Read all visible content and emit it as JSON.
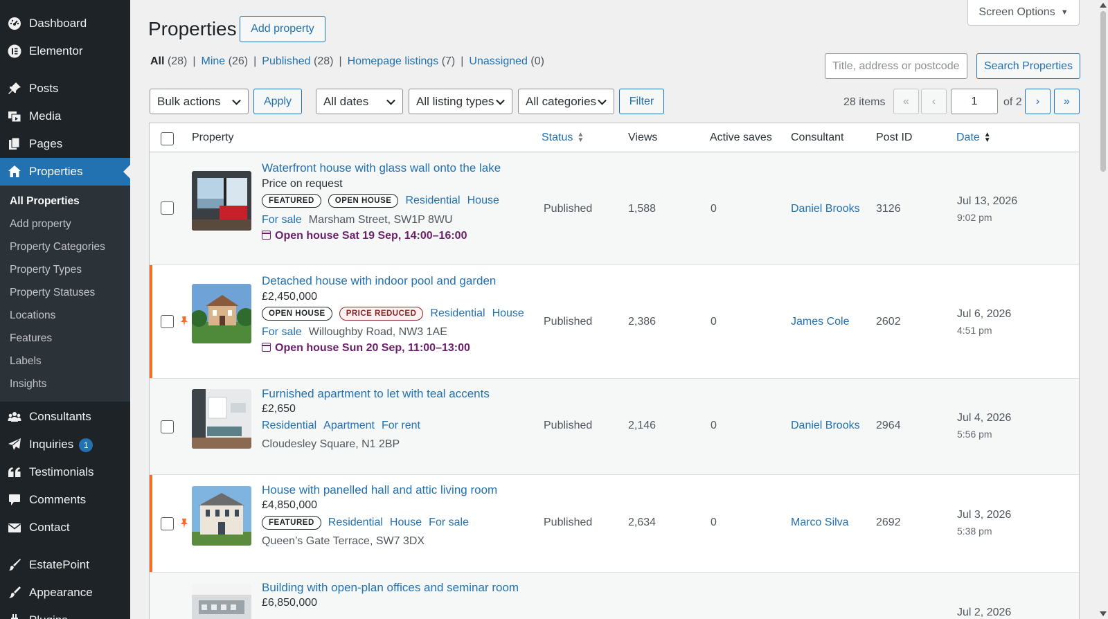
{
  "sidebar": {
    "menu": [
      {
        "label": "Dashboard",
        "icon": "dashboard-icon"
      },
      {
        "label": "Elementor",
        "icon": "elementor-icon"
      },
      {
        "label": "Posts",
        "icon": "pin-icon"
      },
      {
        "label": "Media",
        "icon": "media-icon"
      },
      {
        "label": "Pages",
        "icon": "pages-icon"
      },
      {
        "label": "Properties",
        "icon": "home-icon"
      },
      {
        "label": "Consultants",
        "icon": "groups-icon"
      },
      {
        "label": "Inquiries",
        "icon": "paper-plane-icon",
        "badge": "1"
      },
      {
        "label": "Testimonials",
        "icon": "quote-icon"
      },
      {
        "label": "Comments",
        "icon": "comment-icon"
      },
      {
        "label": "Contact",
        "icon": "envelope-icon"
      },
      {
        "label": "EstatePoint",
        "icon": "brush-icon"
      },
      {
        "label": "Appearance",
        "icon": "paintbrush-icon"
      },
      {
        "label": "Plugins",
        "icon": "plugin-icon"
      }
    ],
    "submenu": [
      "All Properties",
      "Add property",
      "Property Categories",
      "Property Types",
      "Property Statuses",
      "Locations",
      "Features",
      "Labels",
      "Insights"
    ]
  },
  "header": {
    "title": "Properties",
    "add_button": "Add property",
    "screen_options": "Screen Options"
  },
  "filters_links": {
    "all_label": "All",
    "all_count": "(28)",
    "mine_label": "Mine",
    "mine_count": "(26)",
    "published_label": "Published",
    "published_count": "(28)",
    "homepage_label": "Homepage listings",
    "homepage_count": "(7)",
    "unassigned_label": "Unassigned",
    "unassigned_count": "(0)"
  },
  "search": {
    "placeholder": "Title, address or postcode",
    "button": "Search Properties"
  },
  "toolbar": {
    "bulk_actions": "Bulk actions",
    "apply": "Apply",
    "dates": "All dates",
    "listing_types": "All listing types",
    "categories": "All categories",
    "filter": "Filter"
  },
  "pagination": {
    "items": "28 items",
    "first": "«",
    "prev": "‹",
    "current": "1",
    "of": "of 2",
    "next": "›",
    "last": "»"
  },
  "table": {
    "headers": {
      "property": "Property",
      "status": "Status",
      "views": "Views",
      "active_saves": "Active saves",
      "consultant": "Consultant",
      "post_id": "Post ID",
      "date": "Date"
    },
    "rows": [
      {
        "title": "Waterfront house with glass wall onto the lake",
        "price": "Price on request",
        "tags": [
          "FEATURED",
          "OPEN HOUSE"
        ],
        "taxonomies": [
          "Residential",
          "House"
        ],
        "listing": "For sale",
        "address": "Marsham Street, SW1P 8WU",
        "open_house": "Open house Sat 19 Sep, 14:00–16:00",
        "status": "Published",
        "views": "1,588",
        "saves": "0",
        "consultant": "Daniel Brooks",
        "post_id": "3126",
        "date": "Jul 13, 2026",
        "time": "9:02 pm"
      },
      {
        "title": "Detached house with indoor pool and garden",
        "price": "£2,450,000",
        "tags": [
          "OPEN HOUSE",
          "PRICE REDUCED"
        ],
        "taxonomies": [
          "Residential",
          "House"
        ],
        "listing": "For sale",
        "address": "Willoughby Road, NW3 1AE",
        "open_house": "Open house Sun 20 Sep, 11:00–13:00",
        "status": "Published",
        "views": "2,386",
        "saves": "0",
        "consultant": "James Cole",
        "post_id": "2602",
        "date": "Jul 6, 2026",
        "time": "4:51 pm"
      },
      {
        "title": "Furnished apartment to let with teal accents",
        "price": "£2,650",
        "taxonomies": [
          "Residential",
          "Apartment",
          "For rent"
        ],
        "address": "Cloudesley Square, N1 2BP",
        "status": "Published",
        "views": "2,146",
        "saves": "0",
        "consultant": "Daniel Brooks",
        "post_id": "2964",
        "date": "Jul 4, 2026",
        "time": "5:56 pm"
      },
      {
        "title": "House with panelled hall and attic living room",
        "price": "£4,850,000",
        "tags": [
          "FEATURED"
        ],
        "taxonomies": [
          "Residential",
          "House",
          "For sale"
        ],
        "address": "Queen’s Gate Terrace, SW7 3DX",
        "status": "Published",
        "views": "2,634",
        "saves": "0",
        "consultant": "Marco Silva",
        "post_id": "2692",
        "date": "Jul 3, 2026",
        "time": "5:38 pm"
      },
      {
        "title": "Building with open-plan offices and seminar room",
        "price": "£6,850,000",
        "date": "Jul 2, 2026"
      }
    ]
  },
  "colors": {
    "accent": "#2271b1",
    "sidebar_bg": "#1d2327",
    "sticky_marker": "#f56e28",
    "open_house": "#6b1f6b"
  }
}
